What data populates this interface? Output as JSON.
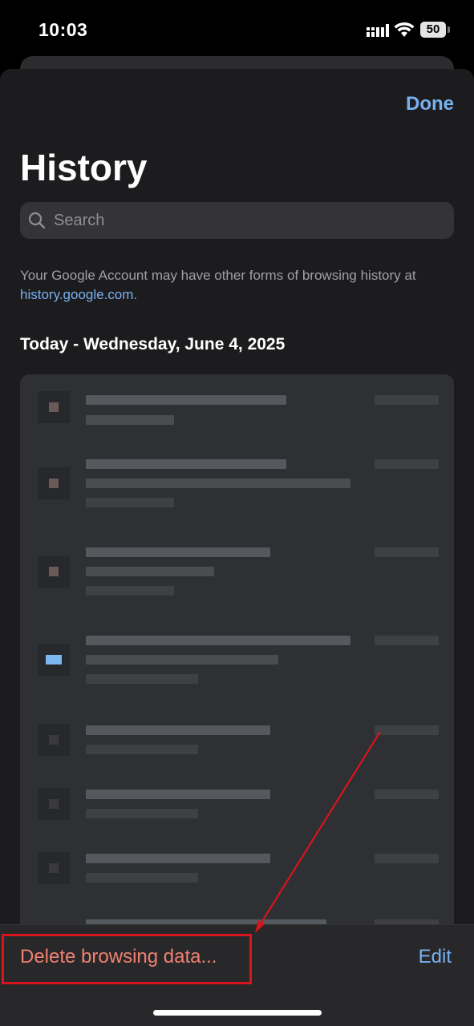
{
  "status_bar": {
    "time": "10:03",
    "battery": "50"
  },
  "header": {
    "done_label": "Done",
    "title": "History"
  },
  "search": {
    "placeholder": "Search"
  },
  "info": {
    "text": "Your Google Account may have other forms of browsing history at ",
    "link": "history.google.com",
    "suffix": "."
  },
  "section": {
    "date": "Today - Wednesday, June 4, 2025"
  },
  "toolbar": {
    "delete_label": "Delete browsing data...",
    "edit_label": "Edit"
  },
  "colors": {
    "accent": "#78b0f0",
    "destructive": "#f08070",
    "annotation": "#d8141c"
  }
}
